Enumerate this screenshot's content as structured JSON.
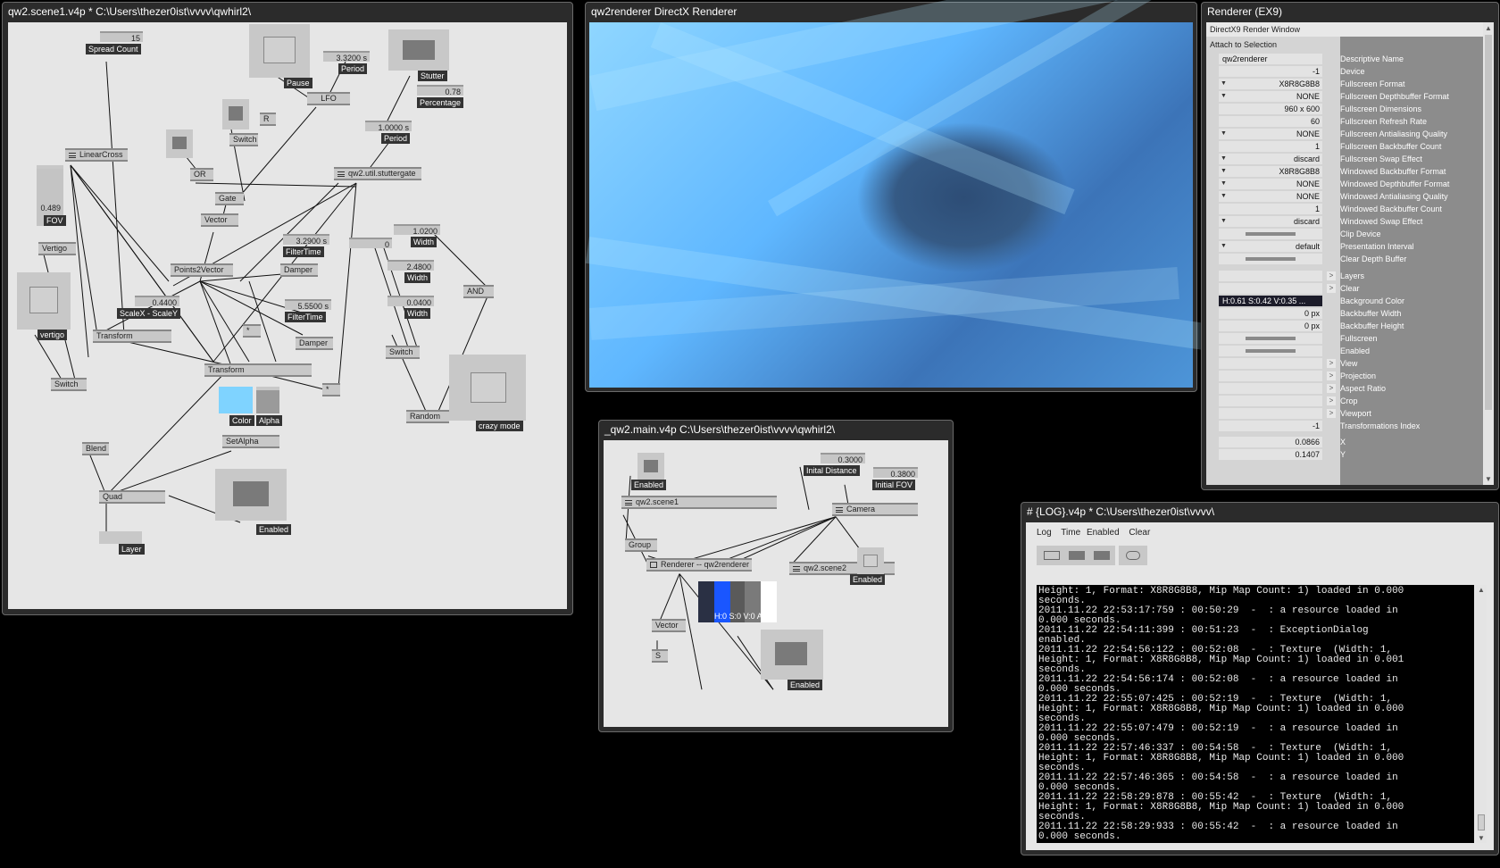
{
  "scene1": {
    "title": "qw2.scene1.v4p *  C:\\Users\\thezer0ist\\vvvv\\qwhirl2\\",
    "labels": {
      "spread_count": "Spread Count",
      "pause": "Pause",
      "period1": "Period",
      "stutter": "Stutter",
      "percentage": "Percentage",
      "lfo": "LFO",
      "r": "R",
      "switch1": "Switch",
      "period2": "Period",
      "linearcross": "LinearCross",
      "or": "OR",
      "gate": "Gate",
      "stuttergate": "qw2.util.stuttergate",
      "fov": "FOV",
      "vector": "Vector",
      "filtertime1": "FilterTime",
      "damper1": "Damper",
      "width1": "Width",
      "vertigo_label": "Vertigo",
      "points2vector": "Points2Vector",
      "zero": "0",
      "width2": "Width",
      "width3": "Width",
      "and": "AND",
      "scalex": "ScaleX - ScaleY",
      "filtertime2": "FilterTime",
      "transform1": "Transform",
      "star1": "*",
      "damper2": "Damper",
      "switch2": "Switch",
      "vertigo2": "vertigo",
      "transform2": "Transform",
      "switch3": "Switch",
      "star2": "*",
      "random": "Random",
      "crazy_mode": "crazy mode",
      "color": "Color",
      "alpha": "Alpha",
      "setalpha": "SetAlpha",
      "blend": "Blend",
      "quad": "Quad",
      "enabled": "Enabled",
      "layer": "Layer"
    },
    "values": {
      "spread_count": "15",
      "period1": "3.3200 s",
      "percentage": "0.78",
      "period2": "1.0000 s",
      "fov": "0.489",
      "filtertime1": "3.2900 s",
      "width1": "1.0200",
      "zero": "0",
      "width2": "2.4800",
      "width3": "0.0400",
      "scalex": "0.4400",
      "filtertime2": "5.5500 s"
    }
  },
  "renderer": {
    "title": "qw2renderer   DirectX Renderer"
  },
  "main": {
    "title": "_qw2.main.v4p    C:\\Users\\thezer0ist\\vvvv\\qwhirl2\\",
    "labels": {
      "enabled1": "Enabled",
      "initial_distance": "Inital Distance",
      "initial_fov": "Initial FOV",
      "scene1": "qw2.scene1",
      "camera": "Camera",
      "group": "Group",
      "renderer": "Renderer -- qw2renderer",
      "scene2": "qw2.scene2",
      "enabled2": "Enabled",
      "vector": "Vector",
      "s": "S",
      "enabled3": "Enabled"
    },
    "values": {
      "initial_distance": "0.3000",
      "initial_fov": "0.3800",
      "color_readout": "H:0 S:0 V:0 A:1"
    }
  },
  "inspector": {
    "title": "Renderer (EX9)",
    "header": "DirectX9 Render Window",
    "attach": "Attach to Selection",
    "rows": [
      {
        "value": "qw2renderer",
        "key": "Descriptive Name"
      },
      {
        "value": "-1",
        "key": "Device"
      },
      {
        "value": "X8R8G8B8",
        "key": "Fullscreen Format"
      },
      {
        "value": "NONE",
        "key": "Fullscreen Depthbuffer Format"
      },
      {
        "value": "960 x 600",
        "key": "Fullscreen Dimensions"
      },
      {
        "value": "60",
        "key": "Fullscreen Refresh Rate"
      },
      {
        "value": "NONE",
        "key": "Fullscreen Antialiasing Quality"
      },
      {
        "value": "1",
        "key": "Fullscreen Backbuffer Count"
      },
      {
        "value": "discard",
        "key": "Fullscreen Swap Effect"
      },
      {
        "value": "X8R8G8B8",
        "key": "Windowed Backbuffer Format"
      },
      {
        "value": "NONE",
        "key": "Windowed Depthbuffer Format"
      },
      {
        "value": "NONE",
        "key": "Windowed Antialiasing Quality"
      },
      {
        "value": "1",
        "key": "Windowed Backbuffer Count"
      },
      {
        "value": "discard",
        "key": "Windowed Swap Effect"
      },
      {
        "value": "",
        "key": "Clip Device"
      },
      {
        "value": "default",
        "key": "Presentation Interval"
      },
      {
        "value": "",
        "key": "Clear Depth Buffer"
      },
      {
        "value": "",
        "key": "Layers"
      },
      {
        "value": "",
        "key": "Clear"
      },
      {
        "value": "H:0.61  S:0.42  V:0.35  ...",
        "key": "Background Color"
      },
      {
        "value": "0 px",
        "key": "Backbuffer Width"
      },
      {
        "value": "0 px",
        "key": "Backbuffer Height"
      },
      {
        "value": "",
        "key": "Fullscreen"
      },
      {
        "value": "",
        "key": "Enabled"
      },
      {
        "value": "",
        "key": "View"
      },
      {
        "value": "",
        "key": "Projection"
      },
      {
        "value": "",
        "key": "Aspect Ratio"
      },
      {
        "value": "",
        "key": "Crop"
      },
      {
        "value": "",
        "key": "Viewport"
      },
      {
        "value": "-1",
        "key": "Transformations Index"
      },
      {
        "value": "0.0866",
        "key": "X"
      },
      {
        "value": "0.1407",
        "key": "Y"
      }
    ]
  },
  "log": {
    "title": "#  {LOG}.v4p *  C:\\Users\\thezer0ist\\vvvv\\",
    "menu": {
      "log": "Log",
      "time": "Time",
      "enabled": "Enabled",
      "clear": "Clear"
    },
    "text": "Height: 1, Format: X8R8G8B8, Mip Map Count: 1) loaded in 0.000\nseconds.\n2011.11.22 22:53:17:759 : 00:50:29  -  : a resource loaded in\n0.000 seconds.\n2011.11.22 22:54:11:399 : 00:51:23  -  : ExceptionDialog\nenabled.\n2011.11.22 22:54:56:122 : 00:52:08  -  : Texture  (Width: 1,\nHeight: 1, Format: X8R8G8B8, Mip Map Count: 1) loaded in 0.001\nseconds.\n2011.11.22 22:54:56:174 : 00:52:08  -  : a resource loaded in\n0.000 seconds.\n2011.11.22 22:55:07:425 : 00:52:19  -  : Texture  (Width: 1,\nHeight: 1, Format: X8R8G8B8, Mip Map Count: 1) loaded in 0.000\nseconds.\n2011.11.22 22:55:07:479 : 00:52:19  -  : a resource loaded in\n0.000 seconds.\n2011.11.22 22:57:46:337 : 00:54:58  -  : Texture  (Width: 1,\nHeight: 1, Format: X8R8G8B8, Mip Map Count: 1) loaded in 0.000\nseconds.\n2011.11.22 22:57:46:365 : 00:54:58  -  : a resource loaded in\n0.000 seconds.\n2011.11.22 22:58:29:878 : 00:55:42  -  : Texture  (Width: 1,\nHeight: 1, Format: X8R8G8B8, Mip Map Count: 1) loaded in 0.000\nseconds.\n2011.11.22 22:58:29:933 : 00:55:42  -  : a resource loaded in\n0.000 seconds."
  },
  "colors": {
    "color_swatch": "#7fd3ff",
    "hue_bar": "#1a56ff"
  }
}
